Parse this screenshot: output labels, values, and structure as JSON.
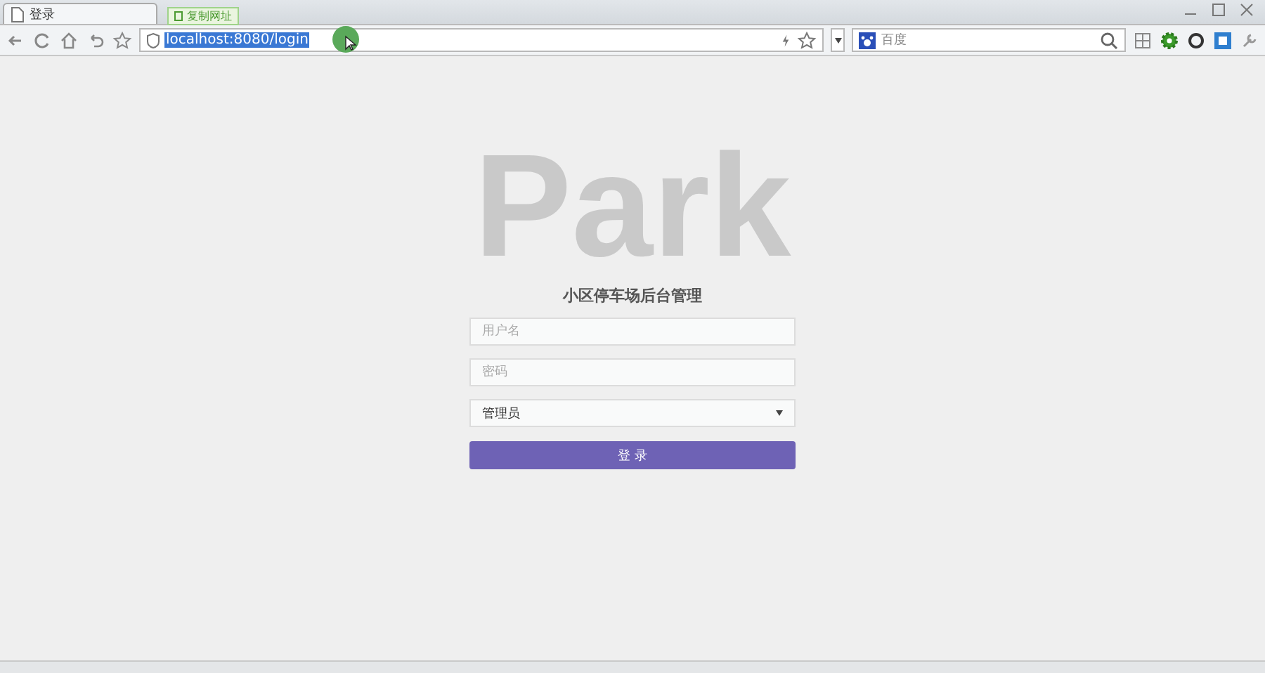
{
  "tab": {
    "title": "登录"
  },
  "tooltip": {
    "text": "复制网址"
  },
  "address_bar": {
    "url": "localhost:8080/login"
  },
  "search_bar": {
    "engine": "百度"
  },
  "page": {
    "backdrop": "Park",
    "title": "小区停车场后台管理",
    "fields": [
      {
        "kind": "text",
        "placeholder": "用户名"
      },
      {
        "kind": "password",
        "placeholder": "密码"
      },
      {
        "kind": "select",
        "value": "管理员"
      }
    ],
    "submit": "登 录"
  }
}
